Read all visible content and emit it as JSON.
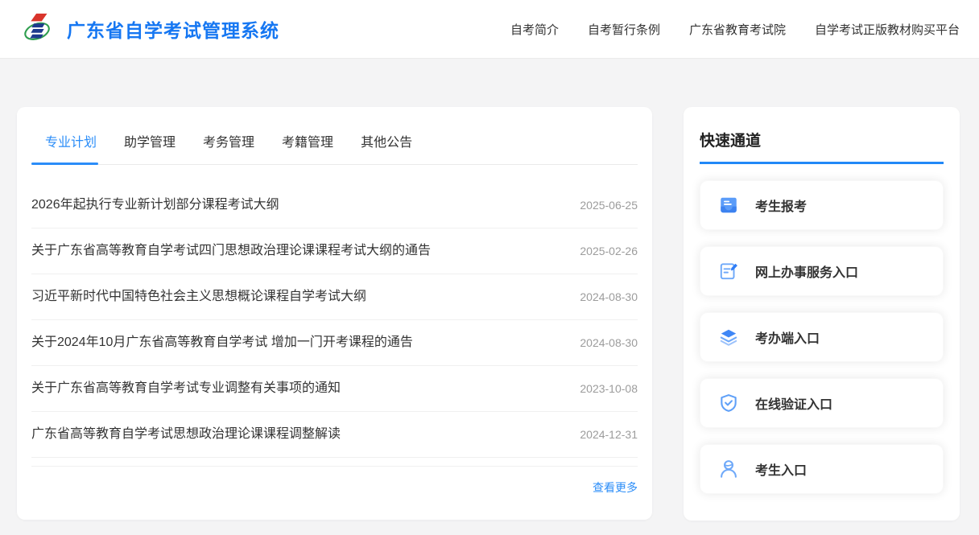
{
  "colors": {
    "primary": "#2b8df8",
    "brand_title": "#1677f2",
    "background": "#f4f4f5"
  },
  "header": {
    "title": "广东省自学考试管理系统",
    "nav": [
      {
        "label": "自考简介"
      },
      {
        "label": "自考暂行条例"
      },
      {
        "label": "广东省教育考试院"
      },
      {
        "label": "自学考试正版教材购买平台"
      }
    ]
  },
  "main": {
    "tabs": [
      {
        "label": "专业计划",
        "active": true
      },
      {
        "label": "助学管理",
        "active": false
      },
      {
        "label": "考务管理",
        "active": false
      },
      {
        "label": "考籍管理",
        "active": false
      },
      {
        "label": "其他公告",
        "active": false
      }
    ],
    "news": [
      {
        "title": "2026年起执行专业新计划部分课程考试大纲",
        "date": "2025-06-25"
      },
      {
        "title": "关于广东省高等教育自学考试四门思想政治理论课课程考试大纲的通告",
        "date": "2025-02-26"
      },
      {
        "title": "习近平新时代中国特色社会主义思想概论课程自学考试大纲",
        "date": "2024-08-30"
      },
      {
        "title": "关于2024年10月广东省高等教育自学考试 增加一门开考课程的通告",
        "date": "2024-08-30"
      },
      {
        "title": "关于广东省高等教育自学考试专业调整有关事项的通知",
        "date": "2023-10-08"
      },
      {
        "title": "广东省高等教育自学考试思想政治理论课课程调整解读",
        "date": "2024-12-31"
      }
    ],
    "more_label": "查看更多"
  },
  "sidebar": {
    "title": "快速通道",
    "links": [
      {
        "label": "考生报考",
        "icon": "inbox-icon"
      },
      {
        "label": "网上办事服务入口",
        "icon": "form-edit-icon"
      },
      {
        "label": "考办端入口",
        "icon": "layers-icon"
      },
      {
        "label": "在线验证入口",
        "icon": "shield-check-icon"
      },
      {
        "label": "考生入口",
        "icon": "user-icon"
      }
    ]
  }
}
